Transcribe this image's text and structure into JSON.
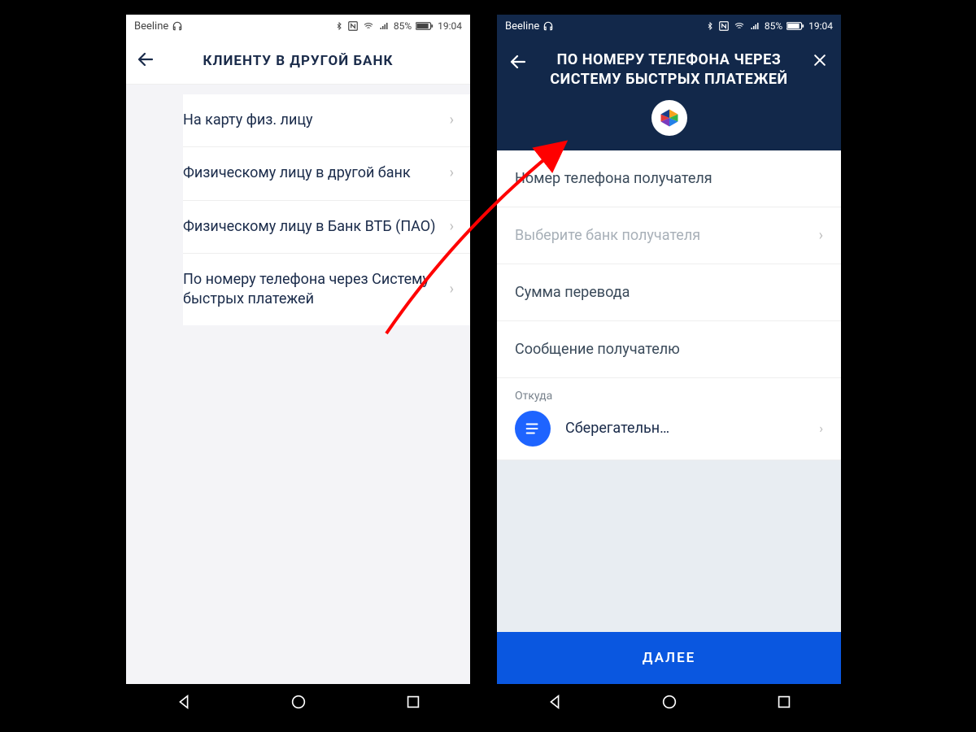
{
  "statusbar": {
    "carrier": "Beeline",
    "battery": "85%",
    "time": "19:04"
  },
  "left": {
    "title": "КЛИЕНТУ В ДРУГОЙ БАНК",
    "items": [
      "На карту физ. лицу",
      "Физическому лицу в другой банк",
      "Физическому лицу в Банк ВТБ (ПАО)",
      "По номеру телефона через Систему быстрых платежей"
    ]
  },
  "right": {
    "title": "ПО НОМЕРУ ТЕЛЕФОНА ЧЕРЕЗ СИСТЕМУ БЫСТРЫХ ПЛАТЕЖЕЙ",
    "fields": {
      "phone": "Номер телефона получателя",
      "bank": "Выберите банк получателя",
      "amount": "Сумма перевода",
      "message": "Сообщение получателю"
    },
    "source": {
      "label": "Откуда",
      "name": "Сберегательн…"
    },
    "next": "ДАЛЕЕ"
  }
}
